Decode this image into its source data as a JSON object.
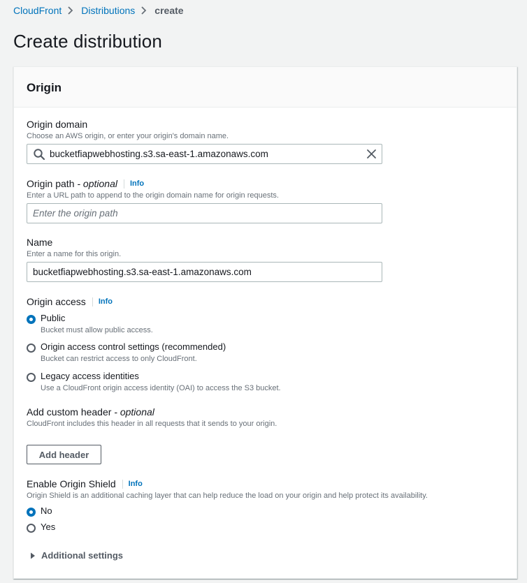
{
  "breadcrumb": {
    "items": [
      {
        "label": "CloudFront"
      },
      {
        "label": "Distributions"
      }
    ],
    "current": "create"
  },
  "page": {
    "title": "Create distribution"
  },
  "origin_panel": {
    "title": "Origin",
    "origin_domain": {
      "label": "Origin domain",
      "description": "Choose an AWS origin, or enter your origin's domain name.",
      "value": "bucketfiapwebhosting.s3.sa-east-1.amazonaws.com"
    },
    "origin_path": {
      "label": "Origin path",
      "optional": "- optional",
      "info": "Info",
      "description": "Enter a URL path to append to the origin domain name for origin requests.",
      "placeholder": "Enter the origin path"
    },
    "name": {
      "label": "Name",
      "description": "Enter a name for this origin.",
      "value": "bucketfiapwebhosting.s3.sa-east-1.amazonaws.com"
    },
    "origin_access": {
      "label": "Origin access",
      "info": "Info",
      "options": [
        {
          "label": "Public",
          "description": "Bucket must allow public access.",
          "checked": true
        },
        {
          "label": "Origin access control settings (recommended)",
          "description": "Bucket can restrict access to only CloudFront.",
          "checked": false
        },
        {
          "label": "Legacy access identities",
          "description": "Use a CloudFront origin access identity (OAI) to access the S3 bucket.",
          "checked": false
        }
      ]
    },
    "custom_header": {
      "label": "Add custom header",
      "optional": "- optional",
      "description": "CloudFront includes this header in all requests that it sends to your origin.",
      "button": "Add header"
    },
    "origin_shield": {
      "label": "Enable Origin Shield",
      "info": "Info",
      "description": "Origin Shield is an additional caching layer that can help reduce the load on your origin and help protect its availability.",
      "options": [
        {
          "label": "No",
          "checked": true
        },
        {
          "label": "Yes",
          "checked": false
        }
      ]
    },
    "additional_settings": "Additional settings"
  },
  "colors": {
    "link": "#0073bb",
    "text": "#16191f",
    "muted": "#687078",
    "background": "#f2f3f3"
  },
  "icons": {
    "search": "search-icon",
    "clear": "close-icon",
    "separator": "chevron-right-icon",
    "expander": "caret-right-icon"
  }
}
